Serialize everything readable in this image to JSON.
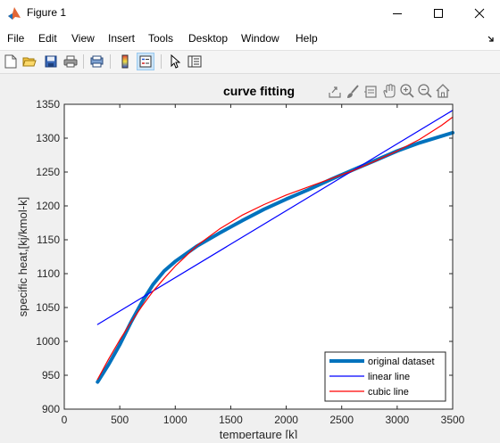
{
  "window": {
    "title": "Figure 1",
    "app_icon": "matlab-icon"
  },
  "menu": [
    "File",
    "Edit",
    "View",
    "Insert",
    "Tools",
    "Desktop",
    "Window",
    "Help"
  ],
  "toolbar_icons": [
    "new-figure-icon",
    "open-file-icon",
    "save-icon",
    "print-icon",
    "print-preview-icon",
    "link-plot-icon",
    "insert-colorbar-icon",
    "insert-legend-icon",
    "edit-plot-pointer-icon",
    "property-inspector-icon"
  ],
  "axes_toolbar_icons": [
    "export-icon",
    "brush-icon",
    "datatip-icon",
    "pan-hand-icon",
    "zoom-in-icon",
    "zoom-out-icon",
    "home-icon"
  ],
  "chart_data": {
    "type": "line",
    "title": "curve fitting",
    "xlabel": "tempertaure [k]",
    "ylabel": "specific heat,[kj/kmol-k]",
    "xlim": [
      0,
      3500
    ],
    "ylim": [
      900,
      1350
    ],
    "xticks": [
      0,
      500,
      1000,
      1500,
      2000,
      2500,
      3000,
      3500
    ],
    "yticks": [
      900,
      950,
      1000,
      1050,
      1100,
      1150,
      1200,
      1250,
      1300,
      1350
    ],
    "grid": false,
    "legend_position": "bottom-right",
    "series": [
      {
        "name": "original dataset",
        "color": "#0072bd",
        "x": [
          300,
          400,
          500,
          600,
          700,
          800,
          900,
          1000,
          1200,
          1400,
          1600,
          1800,
          2000,
          2200,
          2400,
          2600,
          2800,
          3000,
          3200,
          3400,
          3500
        ],
        "y": [
          940,
          966,
          995,
          1028,
          1058,
          1084,
          1104,
          1118,
          1141,
          1160,
          1178,
          1195,
          1210,
          1224,
          1239,
          1253,
          1267,
          1281,
          1293,
          1303,
          1308
        ]
      },
      {
        "name": "linear line",
        "color": "#0000ff",
        "x": [
          300,
          3500
        ],
        "y": [
          1025,
          1341
        ]
      },
      {
        "name": "cubic line",
        "color": "#ff0000",
        "x": [
          300,
          400,
          500,
          600,
          700,
          800,
          900,
          1000,
          1200,
          1400,
          1600,
          1800,
          2000,
          2200,
          2400,
          2600,
          2800,
          3000,
          3200,
          3400,
          3500
        ],
        "y": [
          944,
          974,
          1002,
          1028,
          1052,
          1074,
          1093,
          1111,
          1142,
          1166,
          1186,
          1202,
          1216,
          1228,
          1240,
          1252,
          1266,
          1281,
          1298,
          1319,
          1331
        ]
      }
    ]
  }
}
